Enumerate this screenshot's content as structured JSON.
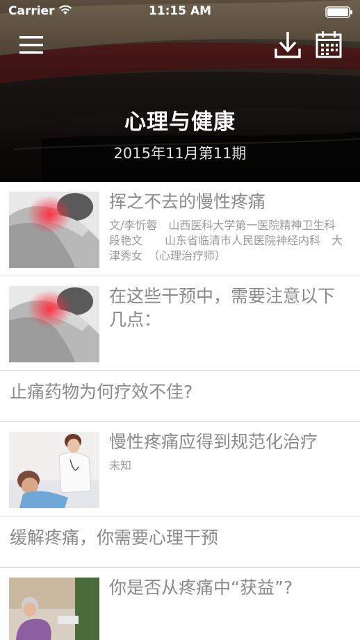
{
  "status_bar": {
    "carrier": "Carrier",
    "time": "11:15 AM"
  },
  "header": {
    "title": "心理与健康",
    "issue": "2015年11月第11期",
    "icons": [
      "menu-icon",
      "download-icon",
      "calendar-icon"
    ]
  },
  "articles": [
    {
      "title": "挥之不去的慢性疼痛",
      "meta": "文/李忻蓉　山西医科大学第一医院精神卫生科　段艳文　　山东省临清市人民医院神经内科　大津秀女　（心理治疗师）"
    },
    {
      "title": "在这些干预中，需要注意以下几点："
    },
    {
      "title": "止痛药物为何疗效不佳?"
    },
    {
      "title": "慢性疼痛应得到规范化治疗",
      "meta": "未知"
    },
    {
      "title": "缓解疼痛，你需要心理干预"
    },
    {
      "title": "你是否从疼痛中“获益”?"
    }
  ],
  "colors": {
    "header_bg": "#151313",
    "title_text": "#8a8a8a",
    "meta_text": "#9a9a9a",
    "divider": "#dcdcdc"
  }
}
